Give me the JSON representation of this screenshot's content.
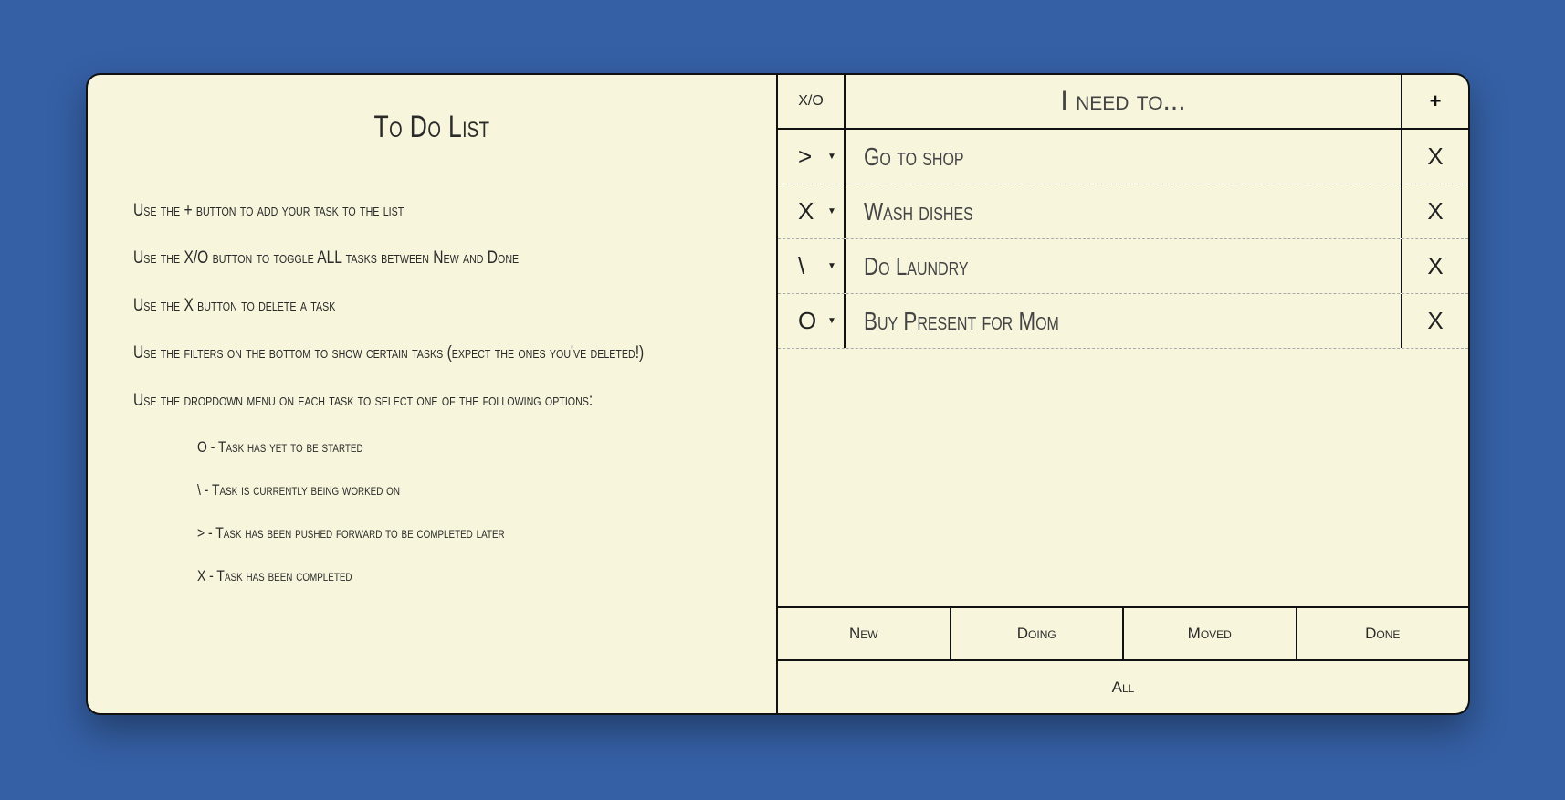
{
  "left": {
    "title": "To Do List",
    "instructions": [
      "Use the + button to add your task to the list",
      "Use the X/O button to toggle ALL tasks between New and Done",
      "Use the X button to delete a task",
      "Use the filters on the bottom to show certain tasks (expect the ones you've deleted!)",
      "Use the dropdown menu on each task to select one of the following options:"
    ],
    "options": [
      "O - Task has yet to be started",
      "\\ - Task is currently being worked on",
      "> - Task has been pushed forward to be completed later",
      "X - Task has been completed"
    ]
  },
  "header": {
    "toggle_label": "X/O",
    "input_placeholder": "I need to...",
    "add_label": "+"
  },
  "tasks": [
    {
      "status": ">",
      "text": "Go to shop",
      "delete": "X"
    },
    {
      "status": "X",
      "text": "Wash dishes",
      "delete": "X"
    },
    {
      "status": "\\",
      "text": "Do Laundry",
      "delete": "X"
    },
    {
      "status": "O",
      "text": "Buy Present for Mom",
      "delete": "X"
    }
  ],
  "filters": [
    "New",
    "Doing",
    "Moved",
    "Done"
  ],
  "all_label": "All"
}
